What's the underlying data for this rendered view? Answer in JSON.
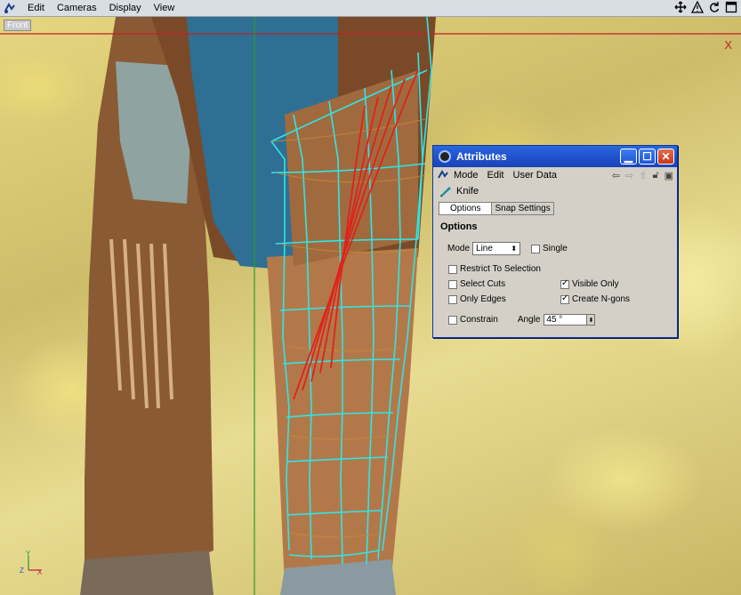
{
  "menubar": {
    "items": [
      "Edit",
      "Cameras",
      "Display",
      "View"
    ],
    "right_icons": [
      "move-icon",
      "warning-icon",
      "rotate-icon",
      "maximize-icon"
    ]
  },
  "viewport": {
    "label": "Front",
    "axis_x_label": "X",
    "colors": {
      "axis_x": "#c0202a",
      "axis_y": "#2c9a2c",
      "mesh": "#2ee6e6",
      "cuts": "#e0221a"
    }
  },
  "attributes": {
    "title": "Attributes",
    "menu": [
      "Mode",
      "Edit",
      "User Data"
    ],
    "tool_name": "Knife",
    "tabs": [
      "Options",
      "Snap Settings"
    ],
    "section": "Options",
    "mode_label": "Mode",
    "mode_value": "Line",
    "single_label": "Single",
    "single_checked": false,
    "restrict_label": "Restrict To Selection",
    "restrict_checked": false,
    "select_cuts_label": "Select Cuts",
    "select_cuts_checked": false,
    "visible_only_label": "Visible Only",
    "visible_only_checked": true,
    "only_edges_label": "Only Edges",
    "only_edges_checked": false,
    "create_ngons_label": "Create N-gons",
    "create_ngons_checked": true,
    "constrain_label": "Constrain",
    "constrain_checked": false,
    "angle_label": "Angle",
    "angle_value": "45 °"
  }
}
